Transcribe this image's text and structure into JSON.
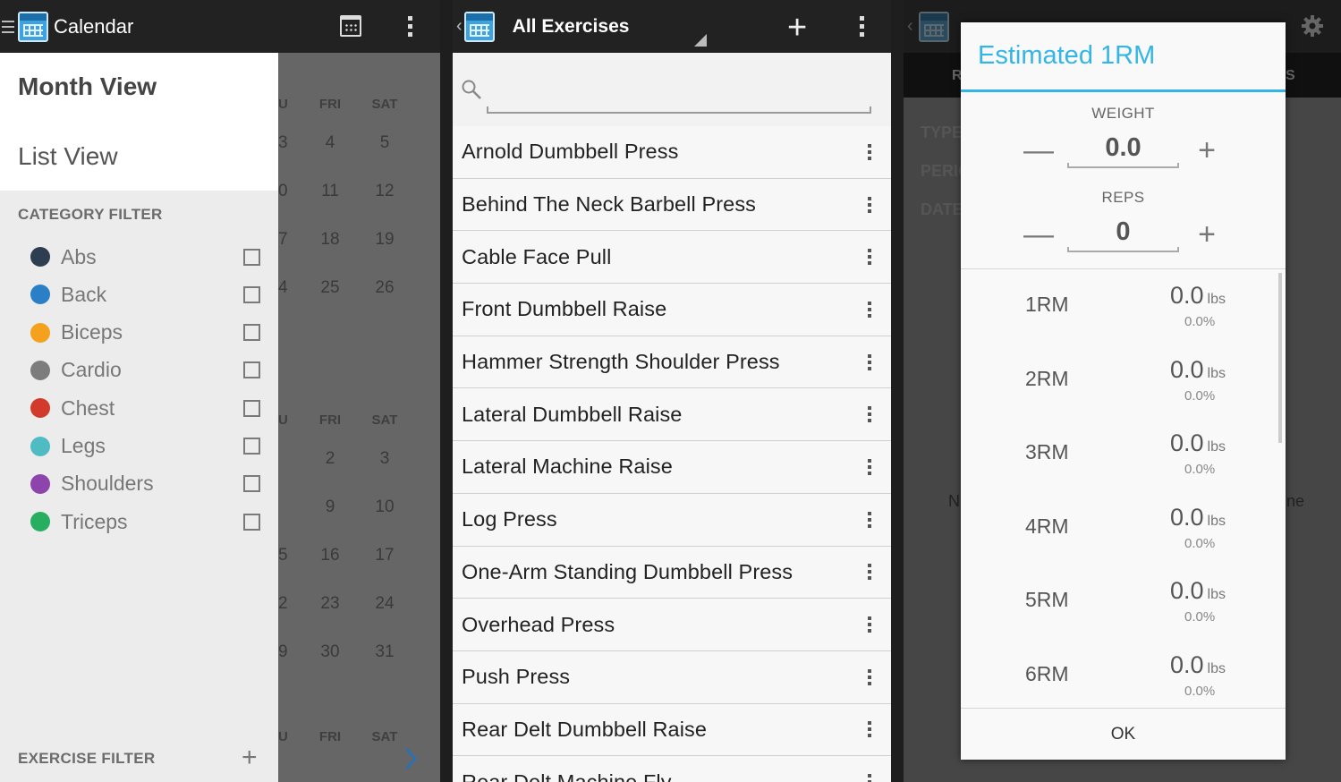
{
  "calendar_screen": {
    "title": "Calendar",
    "nav": {
      "month_view": "Month View",
      "list_view": "List View"
    },
    "category_filter_title": "CATEGORY FILTER",
    "categories": [
      {
        "label": "Abs",
        "color": "#2c3e50"
      },
      {
        "label": "Back",
        "color": "#2b7fc6"
      },
      {
        "label": "Biceps",
        "color": "#f4a21e"
      },
      {
        "label": "Cardio",
        "color": "#7c7c7c"
      },
      {
        "label": "Chest",
        "color": "#d23a2c"
      },
      {
        "label": "Legs",
        "color": "#4fbcc3"
      },
      {
        "label": "Shoulders",
        "color": "#8e44ad"
      },
      {
        "label": "Triceps",
        "color": "#27ae60"
      }
    ],
    "exercise_filter_title": "EXERCISE FILTER",
    "calendar_bg": {
      "month1": {
        "headers": [
          "U",
          "FRI",
          "SAT"
        ],
        "rows": [
          [
            "3",
            "4",
            "5"
          ],
          [
            "0",
            "11",
            "12"
          ],
          [
            "7",
            "18",
            "19"
          ],
          [
            "4",
            "25",
            "26"
          ]
        ]
      },
      "month2": {
        "headers": [
          "U",
          "FRI",
          "SAT"
        ],
        "rows": [
          [
            "",
            "2",
            "3"
          ],
          [
            "",
            "9",
            "10"
          ],
          [
            "5",
            "16",
            "17"
          ],
          [
            "2",
            "23",
            "24"
          ],
          [
            "9",
            "30",
            "31"
          ]
        ]
      },
      "month3_headers": [
        "U",
        "FRI",
        "SAT"
      ]
    }
  },
  "exercises_screen": {
    "title": "All Exercises",
    "exercises": [
      "Arnold Dumbbell Press",
      "Behind The Neck Barbell Press",
      "Cable Face Pull",
      "Front Dumbbell Raise",
      "Hammer Strength Shoulder Press",
      "Lateral Dumbbell Raise",
      "Lateral Machine Raise",
      "Log Press",
      "One-Arm Standing Dumbbell Press",
      "Overhead Press",
      "Push Press",
      "Rear Delt Dumbbell Raise",
      "Rear Delt Machine Fly"
    ]
  },
  "orm_screen": {
    "bg": {
      "type": "TYPE",
      "period": "PERIC",
      "date": "DATE",
      "tab1": "R",
      "tab2": "S",
      "note_left": "N",
      "note_right": "ne"
    },
    "dialog": {
      "title": "Estimated 1RM",
      "weight_label": "WEIGHT",
      "weight_value": "0.0",
      "reps_label": "REPS",
      "reps_value": "0",
      "minus_glyph": "—",
      "plus_glyph": "+",
      "rows": [
        {
          "label": "1RM",
          "value": "0.0",
          "unit": "lbs",
          "percent": "0.0%"
        },
        {
          "label": "2RM",
          "value": "0.0",
          "unit": "lbs",
          "percent": "0.0%"
        },
        {
          "label": "3RM",
          "value": "0.0",
          "unit": "lbs",
          "percent": "0.0%"
        },
        {
          "label": "4RM",
          "value": "0.0",
          "unit": "lbs",
          "percent": "0.0%"
        },
        {
          "label": "5RM",
          "value": "0.0",
          "unit": "lbs",
          "percent": "0.0%"
        },
        {
          "label": "6RM",
          "value": "0.0",
          "unit": "lbs",
          "percent": "0.0%"
        }
      ],
      "ok_label": "OK"
    }
  }
}
